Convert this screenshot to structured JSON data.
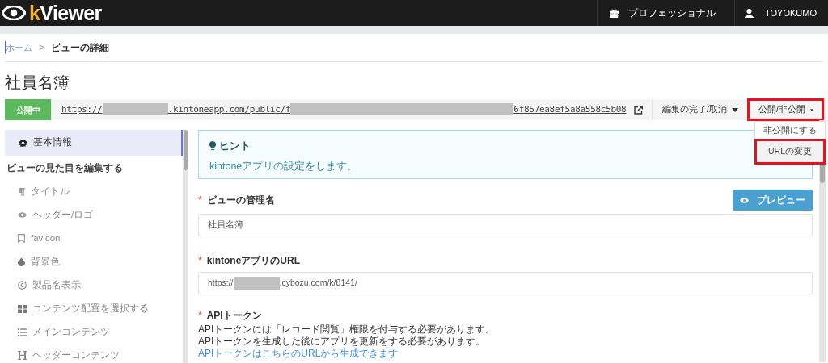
{
  "header": {
    "logo_prefix": "k",
    "logo_rest": "Viewer",
    "plan": "プロフェッショナル",
    "user": "TOYOKUMO"
  },
  "breadcrumb": [
    "ホーム",
    ">",
    "ビューの詳細"
  ],
  "page_title": "社員名簿",
  "status_badge": "公開中",
  "public_url": [
    "https://",
    ".kintoneapp.com/public/f",
    "6f857ea8ef5a8a558c5b08"
  ],
  "actions": [
    {
      "label": "編集の完了/取消",
      "highlighted": false
    },
    {
      "label": "公開/非公開",
      "highlighted": true
    }
  ],
  "dropdown_menu": [
    {
      "label": "非公開にする",
      "highlighted": false
    },
    {
      "label": "URLの変更",
      "highlighted": true
    }
  ],
  "sidebar": {
    "items": [
      {
        "label": "基本情報",
        "kind": "item",
        "selected": true
      },
      {
        "label": "ビューの見た目を編集する",
        "kind": "heading"
      },
      {
        "label": "タイトル",
        "kind": "item",
        "selected": false
      },
      {
        "label": "ヘッダー/ロゴ",
        "kind": "item",
        "selected": false
      },
      {
        "label": "favicon",
        "kind": "item",
        "selected": false
      },
      {
        "label": "背景色",
        "kind": "item",
        "selected": false
      },
      {
        "label": "製品名表示",
        "kind": "item",
        "selected": false
      },
      {
        "label": "コンテンツ配置を選択する",
        "kind": "item",
        "selected": false
      },
      {
        "label": "メインコンテンツ",
        "kind": "item",
        "selected": false
      },
      {
        "label": "ヘッダーコンテンツ",
        "kind": "item",
        "selected": false
      }
    ]
  },
  "hint": {
    "title": "ヒント",
    "text": "kintoneアプリの設定をします。"
  },
  "preview_button": "プレビュー",
  "fields": [
    {
      "required_mark": "*",
      "label": "ビューの管理名",
      "value": [
        "社員名簿"
      ]
    },
    {
      "required_mark": "*",
      "label": "kintoneアプリのURL",
      "value": [
        "https://",
        ".cybozu.com/k/8141/"
      ]
    }
  ],
  "api_token": {
    "required_mark": "*",
    "label": "APIトークン",
    "lines": [
      "APIトークンには「レコード閲覧」権限を付与する必要があります。",
      "APIトークンを生成した後にアプリを更新をする必要があります。"
    ],
    "link": "APIトークンはこちらのURLから生成できます"
  }
}
